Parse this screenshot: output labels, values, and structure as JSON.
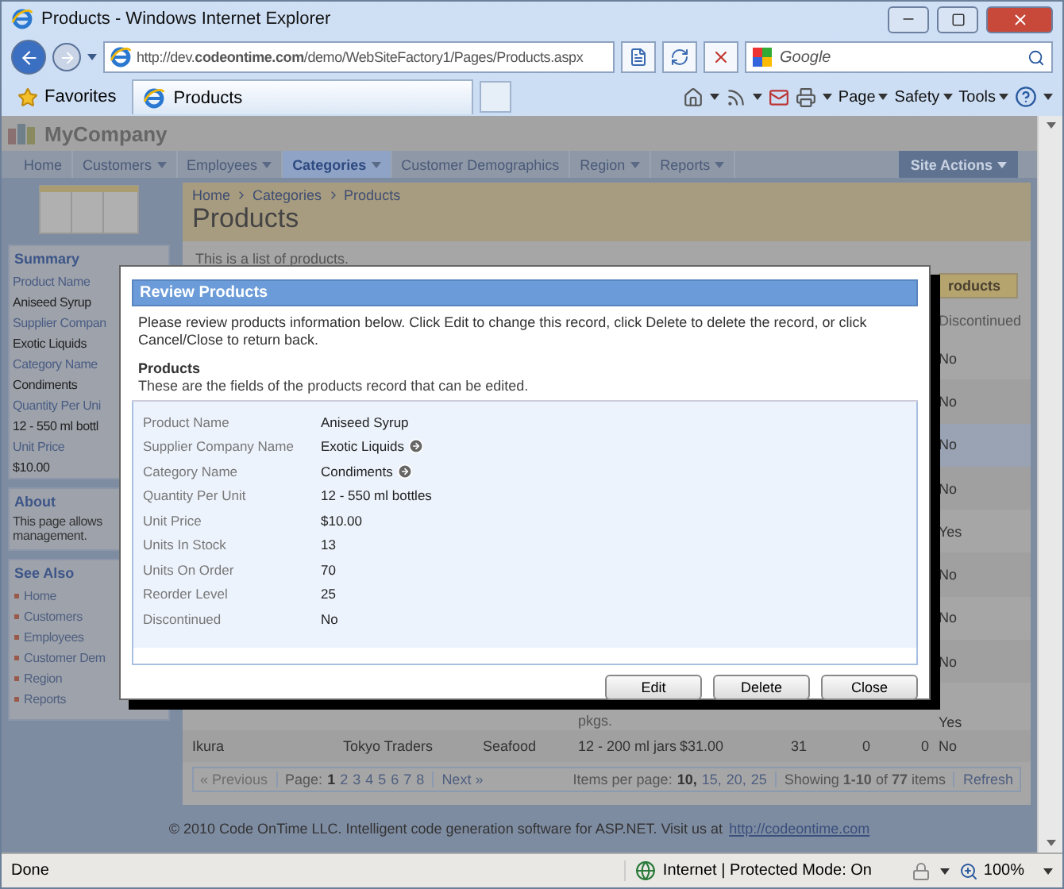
{
  "browser": {
    "title": "Products - Windows Internet Explorer",
    "address": "http://dev.**codeontime.com**/demo/WebSiteFactory1/Pages/Products.aspx",
    "search_placeholder": "Google",
    "favorites": "Favorites",
    "tab": "Products",
    "menus": [
      "Page",
      "Safety",
      "Tools"
    ],
    "status": "Done",
    "zone": "Internet | Protected Mode: On",
    "zoom": "100%"
  },
  "page": {
    "company": "MyCompany",
    "site_actions": "Site Actions",
    "menu": [
      {
        "label": "Home",
        "dropdown": false,
        "selected": false
      },
      {
        "label": "Customers",
        "dropdown": true,
        "selected": false
      },
      {
        "label": "Employees",
        "dropdown": true,
        "selected": false
      },
      {
        "label": "Categories",
        "dropdown": true,
        "selected": true
      },
      {
        "label": "Customer Demographics",
        "dropdown": false,
        "selected": false
      },
      {
        "label": "Region",
        "dropdown": true,
        "selected": false
      },
      {
        "label": "Reports",
        "dropdown": true,
        "selected": false
      }
    ]
  },
  "sidebar": {
    "summary_title": "Summary",
    "fields": [
      {
        "label": "Product Name",
        "value": "Aniseed Syrup"
      },
      {
        "label": "Supplier Compan",
        "value": "Exotic Liquids"
      },
      {
        "label": "Category Name",
        "value": "Condiments"
      },
      {
        "label": "Quantity Per Uni",
        "value": "12 - 550 ml bottl"
      },
      {
        "label": "Unit Price",
        "value": "$10.00"
      }
    ],
    "about_title": "About",
    "about_lines": [
      "This page allows",
      "management."
    ],
    "see_also_title": "See Also",
    "links": [
      "Home",
      "Customers",
      "Employees",
      "Customer Dem",
      "Region",
      "Reports"
    ]
  },
  "main": {
    "breadcrumb": [
      "Home",
      "Categories",
      "Products"
    ],
    "heading": "Products",
    "description": "This is a list of products.",
    "actions_button": "roducts",
    "columns": [
      {
        "label": "Discontinued"
      }
    ],
    "rows": [
      {
        "selected": false,
        "discontinued": "No"
      },
      {
        "selected": false,
        "discontinued": "No"
      },
      {
        "selected": true,
        "discontinued": "No"
      },
      {
        "selected": false,
        "discontinued": "No"
      },
      {
        "selected": false,
        "discontinued": "Yes"
      },
      {
        "selected": false,
        "discontinued": "No"
      },
      {
        "selected": false,
        "discontinued": "No"
      },
      {
        "selected": false,
        "discontinued": "No"
      },
      {
        "selected": false,
        "quantity": "pkgs.",
        "discontinued": "Yes"
      },
      {
        "selected": false,
        "product": "Ikura",
        "supplier": "Tokyo Traders",
        "category": "Seafood",
        "quantity": "12 - 200 ml jars",
        "price": "$31.00",
        "in_stock": "31",
        "on_order": "0",
        "reorder": "0",
        "discontinued": "No"
      }
    ],
    "pager": {
      "previous": "« Previous",
      "previous_disabled": true,
      "page_label": "Page:",
      "pages": [
        {
          "label": "1",
          "selected": true
        },
        {
          "label": "2",
          "selected": false
        },
        {
          "label": "3",
          "selected": false
        },
        {
          "label": "4",
          "selected": false
        },
        {
          "label": "5",
          "selected": false
        },
        {
          "label": "6",
          "selected": false
        },
        {
          "label": "7",
          "selected": false
        },
        {
          "label": "8",
          "selected": false
        }
      ],
      "next": "Next »",
      "per_page_label": "Items per page:",
      "sizes": [
        {
          "label": "10,",
          "selected": true
        },
        {
          "label": "15,",
          "selected": false
        },
        {
          "label": "20,",
          "selected": false
        },
        {
          "label": "25",
          "selected": false
        }
      ],
      "showing": "Showing **1-10** of **77** items",
      "refresh": "Refresh"
    }
  },
  "footer": {
    "text": "© 2010 Code OnTime LLC. Intelligent code generation software for ASP.NET. Visit us at",
    "link": "http://codeontime.com"
  },
  "modal": {
    "title": "Review Products",
    "intro": "Please review products information below. Click Edit to change this record, click Delete to delete the record, or click Cancel/Close to return back.",
    "section_title": "Products",
    "section_description": "These are the fields of the products record that can be edited.",
    "fields": [
      {
        "label": "Product Name",
        "value": "Aniseed Syrup",
        "lookup": false
      },
      {
        "label": "Supplier Company Name",
        "value": "Exotic Liquids",
        "lookup": true
      },
      {
        "label": "Category Name",
        "value": "Condiments",
        "lookup": true
      },
      {
        "label": "Quantity Per Unit",
        "value": "12 - 550 ml bottles",
        "lookup": false
      },
      {
        "label": "Unit Price",
        "value": "$10.00",
        "lookup": false
      },
      {
        "label": "Units In Stock",
        "value": "13",
        "lookup": false
      },
      {
        "label": "Units On Order",
        "value": "70",
        "lookup": false
      },
      {
        "label": "Reorder Level",
        "value": "25",
        "lookup": false
      },
      {
        "label": "Discontinued",
        "value": "No",
        "lookup": false
      }
    ],
    "buttons": [
      "Edit",
      "Delete",
      "Close"
    ]
  }
}
